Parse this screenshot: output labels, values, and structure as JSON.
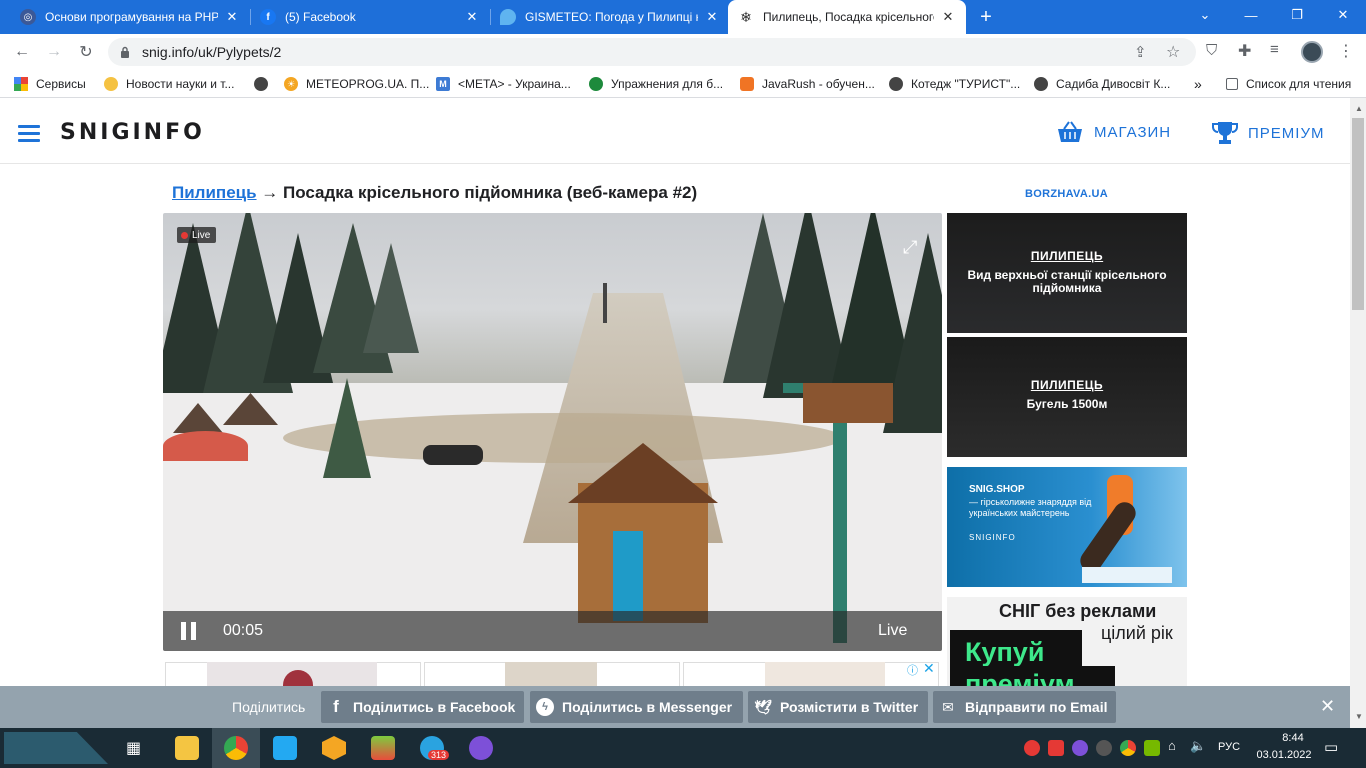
{
  "browser": {
    "tabs": [
      {
        "title": "Основи програмування на PHP",
        "icon": "php-globe-icon",
        "active": false
      },
      {
        "title": "(5) Facebook",
        "icon": "facebook-icon",
        "active": false
      },
      {
        "title": "GISMETEO: Погода у Пилипці на",
        "icon": "gismeteo-drop-icon",
        "active": false
      },
      {
        "title": "Пилипець, Посадка крісельного",
        "icon": "snowflake-icon",
        "active": true
      }
    ],
    "new_tab_symbol": "+",
    "url": "snig.info/uk/Pylypets/2",
    "bookmarks": [
      {
        "label": "Сервисы",
        "icon": "apps-grid-icon"
      },
      {
        "label": "Новости науки и т...",
        "icon": "science-news-icon"
      },
      {
        "label": "",
        "icon": "globe-icon"
      },
      {
        "label": "METEOPROG.UA. П...",
        "icon": "meteoprog-icon"
      },
      {
        "label": "<META> - Украина...",
        "icon": "meta-icon"
      },
      {
        "label": "Упражнения для б...",
        "icon": "exercise-icon"
      },
      {
        "label": "JavaRush - обучен...",
        "icon": "javarush-icon"
      },
      {
        "label": "Котедж \"ТУРИСТ\"...",
        "icon": "globe-icon"
      },
      {
        "label": "Садиба Дивосвіт К...",
        "icon": "globe-icon"
      }
    ],
    "bookmarks_overflow": "»",
    "reading_list": "Список для чтения"
  },
  "site": {
    "logo": "SNIGINFO",
    "shop_label": "МАГАЗИН",
    "premium_label": "ПРЕМІУМ"
  },
  "main": {
    "crumb_link": "Пилипець",
    "crumb_rest": "→ Посадка крісельного підйомника (веб-камера #2)",
    "partner": "BORZHAVA.UA",
    "player": {
      "live_badge": "Live",
      "time": "00:05",
      "live_label": "Live"
    },
    "sidebar": [
      {
        "title": "ПИЛИПЕЦЬ",
        "subtitle": "Вид верхньої станції крісельного підйомника"
      },
      {
        "title": "ПИЛИПЕЦЬ",
        "subtitle": "Бугель 1500м"
      }
    ],
    "shop_ad": {
      "brand": "SNIG.SHOP",
      "tagline": "— гірськолижне знаряддя від українських майстерень",
      "logo": "SNIGINFO"
    },
    "premium_ad": {
      "line1": "СНІГ без реклами",
      "line2": "цілий рік",
      "cta1": "Купуй",
      "cta2": "преміум"
    }
  },
  "share": {
    "label": "Поділитись",
    "facebook": "Поділитись в Facebook",
    "messenger": "Поділитись в Messenger",
    "twitter": "Розмістити в Twitter",
    "email": "Відправити по Email"
  },
  "taskbar": {
    "lang": "РУС",
    "time": "8:44",
    "date": "03.01.2022",
    "telegram_badge": "313"
  },
  "colors": {
    "tab_bar": "#1e6fd9",
    "brand_blue": "#1e73d8",
    "share_bar": "#94a3ae",
    "taskbar": "#1a2b35"
  }
}
